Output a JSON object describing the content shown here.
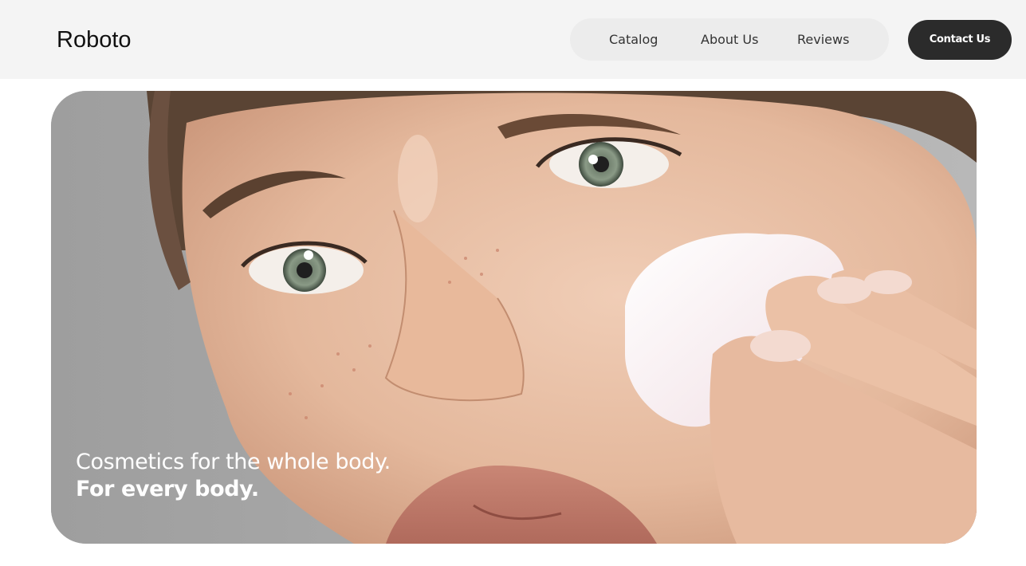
{
  "brand": {
    "logo_text": "Roboto"
  },
  "nav": {
    "items": [
      {
        "label": "Catalog"
      },
      {
        "label": "About Us"
      },
      {
        "label": "Reviews"
      }
    ],
    "contact_label": "Contact Us"
  },
  "hero": {
    "headline_regular": "Cosmetics for the whole body.",
    "headline_bold": "For every body.",
    "image_subject": "close-up of woman's face applying white cream"
  },
  "colors": {
    "header_bg": "#f4f4f4",
    "nav_pill_bg": "#ececec",
    "button_bg": "#2b2b2b",
    "hero_text": "#ffffff"
  }
}
